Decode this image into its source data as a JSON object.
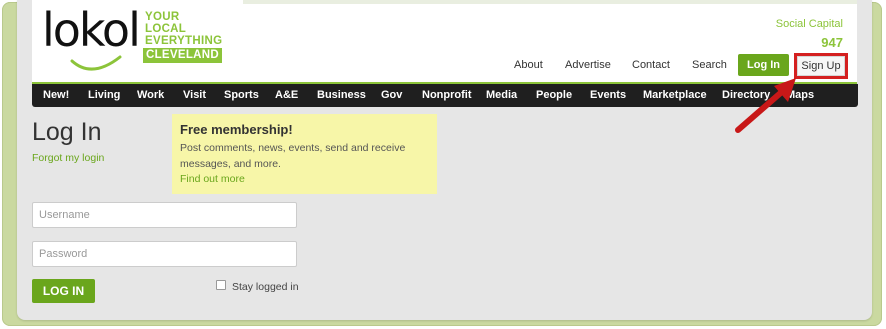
{
  "logo": {
    "word": "lokol",
    "tagline_lines": [
      "YOUR",
      "LOCAL",
      "EVERYTHING"
    ],
    "city": "CLEVELAND"
  },
  "social": {
    "label": "Social Capital",
    "value": "947"
  },
  "top_links": [
    {
      "label": "About"
    },
    {
      "label": "Advertise"
    },
    {
      "label": "Contact"
    },
    {
      "label": "Search"
    }
  ],
  "auth": {
    "login_label": "Log In",
    "signup_label": "Sign Up"
  },
  "nav": {
    "items": [
      {
        "label": "New!"
      },
      {
        "label": "Living"
      },
      {
        "label": "Work"
      },
      {
        "label": "Visit"
      },
      {
        "label": "Sports"
      },
      {
        "label": "A&E"
      },
      {
        "label": "Business"
      },
      {
        "label": "Gov"
      },
      {
        "label": "Nonprofit"
      },
      {
        "label": "Media"
      },
      {
        "label": "People"
      },
      {
        "label": "Events"
      },
      {
        "label": "Marketplace"
      },
      {
        "label": "Directory"
      },
      {
        "label": "Maps"
      }
    ]
  },
  "login": {
    "title": "Log In",
    "forgot": "Forgot my login",
    "username_placeholder": "Username",
    "password_placeholder": "Password",
    "submit": "LOG IN",
    "stay_logged_in": "Stay logged in"
  },
  "promo": {
    "title": "Free membership!",
    "text": "Post comments, news, events, send and receive messages, and more.",
    "link": "Find out more"
  },
  "colors": {
    "brand_green": "#8cc43a",
    "button_green": "#6aa61c",
    "nav_bg": "#1f1f1f",
    "highlight_red": "#d42020",
    "promo_bg": "#f7f6a8"
  }
}
